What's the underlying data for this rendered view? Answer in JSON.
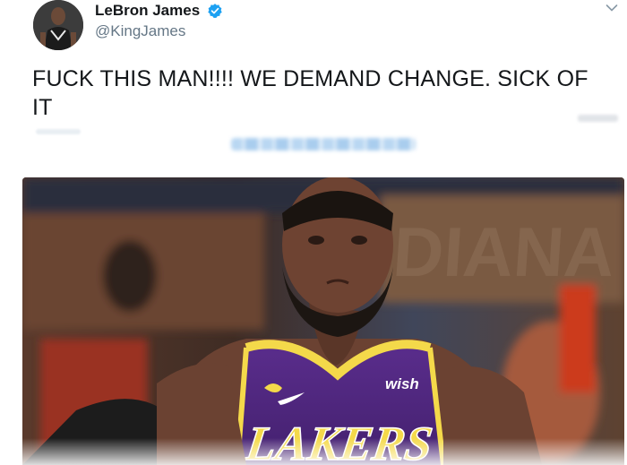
{
  "tweet": {
    "display_name": "LeBron James",
    "handle": "@KingJames",
    "verified": true,
    "text": "FUCK THIS MAN!!!! WE DEMAND CHANGE. SICK OF IT",
    "colors": {
      "text": "#14171a",
      "secondary": "#657786",
      "verified_badge": "#1da1f2"
    },
    "icons": {
      "verified": "verified-badge-icon",
      "menu": "chevron-down-icon"
    },
    "media": {
      "jersey_text": "LAKERS",
      "sponsor_text": "wish",
      "background_text": "DIANA"
    }
  }
}
